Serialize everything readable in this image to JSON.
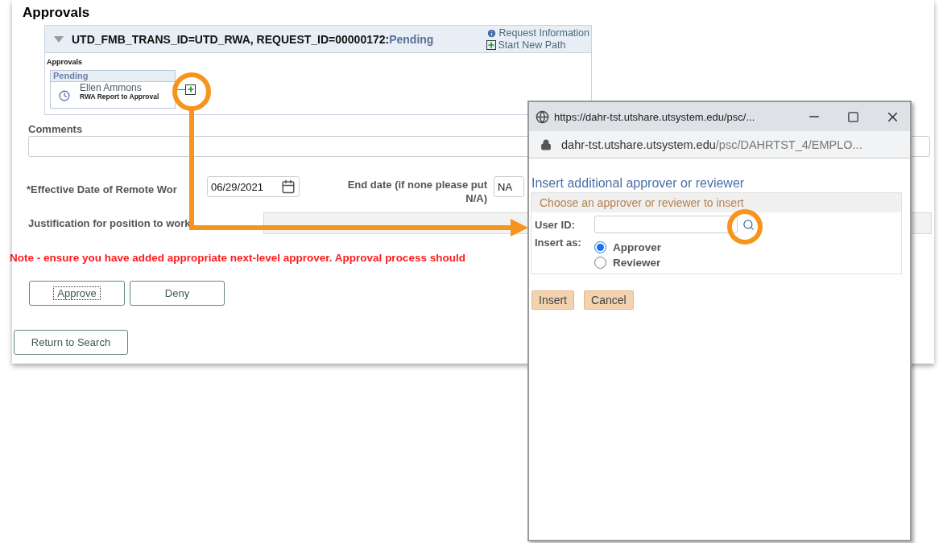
{
  "page": {
    "heading": "Approvals",
    "approval_box": {
      "expanded": true,
      "header_title": "UTD_FMB_TRANS_ID=UTD_RWA, REQUEST_ID=00000172:",
      "status": "Pending",
      "links": [
        {
          "kind": "info",
          "label": "Request Information"
        },
        {
          "kind": "add",
          "label": "Start New Path"
        }
      ],
      "section_label": "Approvals",
      "step": {
        "status": "Pending",
        "approver": "Ellen Ammons",
        "role": "RWA Report to Approval"
      }
    },
    "comments": {
      "label": "Comments"
    },
    "effective_date": {
      "label": "*Effective Date of Remote Wor",
      "value": "06/29/2021"
    },
    "end_date": {
      "label": "End date (if none please put N/A)",
      "value": "NA"
    },
    "justification": {
      "label": "Justification for position to work"
    },
    "note": "Note - ensure you have added appropriate next-level approver. Approval process should",
    "buttons": [
      {
        "label": "Approve",
        "focused": true
      },
      {
        "label": "Deny",
        "focused": false
      }
    ],
    "return_button": "Return to Search"
  },
  "popup": {
    "title_url": "https://dahr-tst.utshare.utsystem.edu/psc/...",
    "address_host": "dahr-tst.utshare.utsystem.edu",
    "address_path": "/psc/DAHRTST_4/EMPLO...",
    "heading": "Insert additional approver or reviewer",
    "group_title": "Choose an approver or reviewer to insert",
    "user_id_label": "User ID:",
    "insert_as_label": "Insert as:",
    "options": [
      {
        "label": "Approver",
        "selected": true
      },
      {
        "label": "Reviewer",
        "selected": false
      }
    ],
    "buttons": [
      "Insert",
      "Cancel"
    ]
  }
}
